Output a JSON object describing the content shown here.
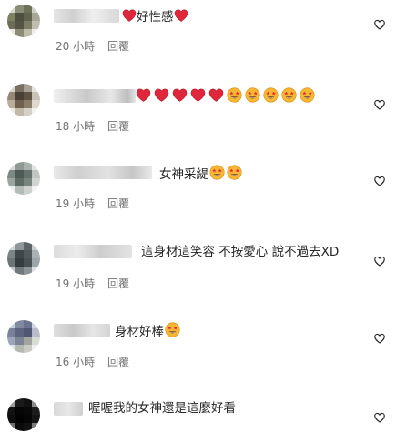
{
  "comments": [
    {
      "text": "好性感",
      "time": "20 小時",
      "reply": "回覆"
    },
    {
      "text": "",
      "time": "18 小時",
      "reply": "回覆"
    },
    {
      "text": "女神采緹",
      "time": "19 小時",
      "reply": "回覆"
    },
    {
      "text": "這身材這笑容 不按愛心 說不過去XD",
      "time": "19 小時",
      "reply": "回覆"
    },
    {
      "text": "身材好棒",
      "time": "16 小時",
      "reply": "回覆"
    },
    {
      "text": "喔喔我的女神還是這麼好看",
      "time": "",
      "reply": ""
    }
  ],
  "icons": {
    "like": "heart-outline-icon",
    "red_heart": "red-heart-emoji",
    "star_eyes": "star-struck-emoji"
  },
  "colors": {
    "text": "#262626",
    "meta": "#737373",
    "heart_red": "#e0263a",
    "emoji_yellow": "#f7b733"
  }
}
